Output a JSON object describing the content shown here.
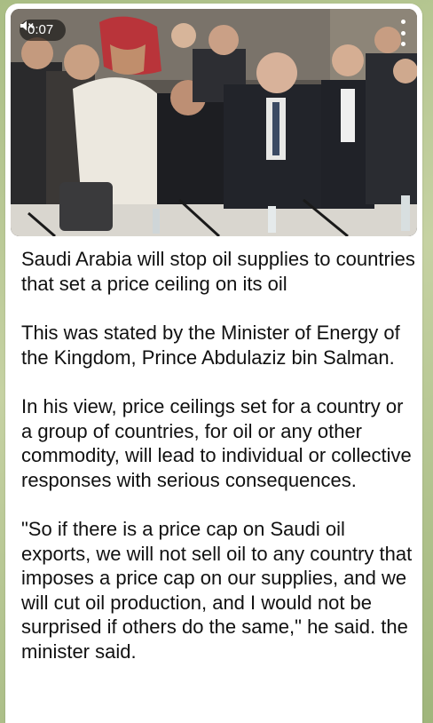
{
  "video": {
    "duration": "0:07",
    "muted": true,
    "mute_icon": "speaker-muted-icon",
    "menu_icon": "more-vertical-icon"
  },
  "message": {
    "paragraphs": [
      "Saudi Arabia will stop oil supplies to countries that set a price ceiling on its oil",
      "This was stated by the Minister of Energy of the Kingdom, Prince Abdulaziz bin Salman.",
      "In his view, price ceilings set for a country or a group of countries, for oil or any other commodity, will lead to individual or collective responses with serious consequences.",
      "\"So if there is a price cap on Saudi oil exports, we will not sell oil to any country that imposes a price cap on our supplies, and we will cut oil production, and I would not be surprised if others do the same,\" he said. the minister said."
    ]
  }
}
